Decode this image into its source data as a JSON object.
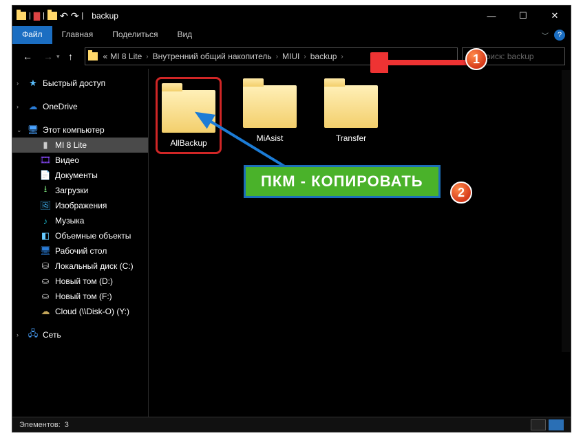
{
  "window": {
    "title": "backup"
  },
  "ribbon": {
    "file": "Файл",
    "home": "Главная",
    "share": "Поделиться",
    "view": "Вид"
  },
  "breadcrumb": {
    "prefix": "«",
    "c1": "MI 8 Lite",
    "c2": "Внутренний общий накопитель",
    "c3": "MIUI",
    "c4": "backup"
  },
  "search": {
    "placeholder": "Поиск: backup"
  },
  "sidebar": {
    "quick": "Быстрый доступ",
    "onedrive": "OneDrive",
    "pc": "Этот компьютер",
    "phone": "MI 8 Lite",
    "video": "Видео",
    "docs": "Документы",
    "downloads": "Загрузки",
    "pictures": "Изображения",
    "music": "Музыка",
    "objects3d": "Объемные объекты",
    "desktop": "Рабочий стол",
    "diskC": "Локальный диск (C:)",
    "diskD": "Новый том (D:)",
    "diskF": "Новый том (F:)",
    "cloud": "Cloud (\\\\Disk-O) (Y:)",
    "network": "Сеть"
  },
  "folders": {
    "f1": "AllBackup",
    "f2": "MiAsist",
    "f3": "Transfer"
  },
  "status": {
    "label": "Элементов:",
    "count": "3"
  },
  "annot": {
    "m1": "1",
    "m2": "2",
    "callout": "ПКМ - КОПИРОВАТЬ"
  }
}
